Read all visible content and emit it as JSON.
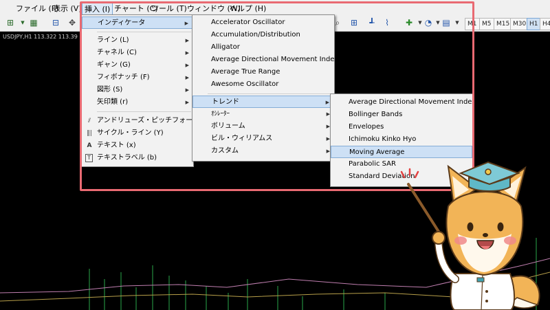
{
  "menubar": {
    "items": [
      "ファイル (F)",
      "表示 (V)",
      "挿入 (I)",
      "チャート (C)",
      "ツール (T)",
      "ウィンドウ (W)",
      "ヘルプ (H)"
    ]
  },
  "toolbar": {
    "timeframes": [
      "M1",
      "M5",
      "M15",
      "M30",
      "H1",
      "H4"
    ]
  },
  "chart": {
    "symbol_label": "USDJPY,H1  113.322  113.39"
  },
  "insert_menu": {
    "items": [
      {
        "label": "インディケータ",
        "icon": "",
        "submenu": true
      },
      {
        "label": "ライン (L)",
        "icon": "",
        "submenu": true
      },
      {
        "label": "チャネル (C)",
        "icon": "",
        "submenu": true
      },
      {
        "label": "ギャン (G)",
        "icon": "",
        "submenu": true
      },
      {
        "label": "フィボナッチ (F)",
        "icon": "",
        "submenu": true
      },
      {
        "label": "図形 (S)",
        "icon": "",
        "submenu": true
      },
      {
        "label": "矢印類 (r)",
        "icon": "",
        "submenu": true
      },
      {
        "label": "アンドリューズ・ピッチフォーク (A)",
        "icon": "pitchfork-icon",
        "submenu": false
      },
      {
        "label": "サイクル・ライン (Y)",
        "icon": "cycle-lines-icon",
        "submenu": false
      },
      {
        "label": "テキスト (x)",
        "icon": "text-icon",
        "submenu": false
      },
      {
        "label": "テキストラベル (b)",
        "icon": "text-label-icon",
        "submenu": false
      }
    ]
  },
  "indicators_menu": {
    "items": [
      "Accelerator Oscillator",
      "Accumulation/Distribution",
      "Alligator",
      "Average Directional Movement Index",
      "Average True Range",
      "Awesome Oscillator"
    ],
    "groups": [
      "トレンド",
      "ｵｼﾚｰﾀｰ",
      "ボリューム",
      "ビル・ウィリアムス",
      "カスタム"
    ]
  },
  "trend_menu": {
    "items": [
      "Average Directional Movement Index",
      "Bollinger Bands",
      "Envelopes",
      "Ichimoku Kinko Hyo",
      "Moving Average",
      "Parabolic SAR",
      "Standard Deviation"
    ]
  },
  "colors": {
    "highlight_frame": "#e96a72",
    "menu_highlight": "#cde0f5"
  }
}
